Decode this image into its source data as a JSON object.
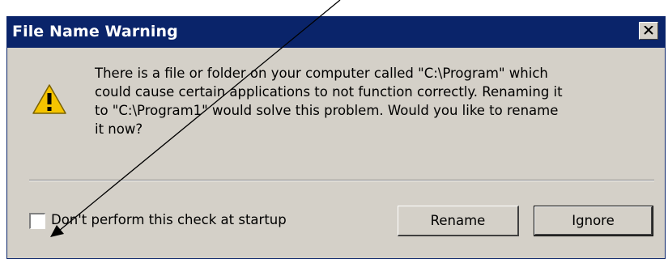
{
  "dialog": {
    "title": "File Name Warning",
    "close_icon": "close-icon",
    "warning_icon": "warning-icon",
    "message_lines": [
      "There is a file or folder on your computer called \"C:\\Program\" which",
      "could cause certain applications to not function correctly.  Renaming it",
      "to \"C:\\Program1\" would solve this problem.  Would you like to rename",
      "it now?"
    ],
    "checkbox": {
      "label": "Don't perform this check at startup",
      "checked": false
    },
    "buttons": {
      "rename": "Rename",
      "ignore": "Ignore"
    }
  },
  "annotation": {
    "type": "arrow-icon",
    "color": "#000000"
  },
  "colors": {
    "titlebar": "#0a246a",
    "dialog_bg": "#d4d0c8",
    "warning_fill": "#f5c400"
  }
}
